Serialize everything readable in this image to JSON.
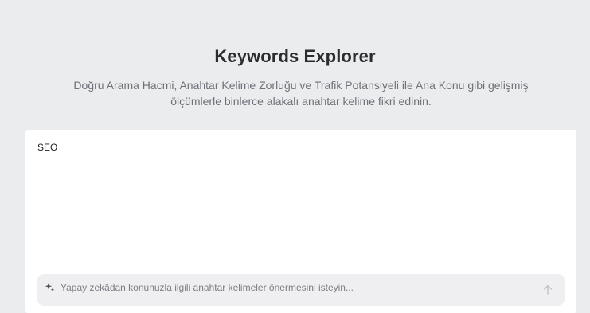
{
  "header": {
    "title": "Keywords Explorer",
    "subtitle": "Doğru Arama Hacmi, Anahtar Kelime Zorluğu ve Trafik Potansiyeli ile Ana Konu gibi gelişmiş ölçümlerle binlerce alakalı anahtar kelime fikri edinin."
  },
  "editor": {
    "keywords_value": "SEO"
  },
  "ai_prompt": {
    "icon": "sparkle-icon",
    "placeholder": "Yapay zekâdan konunuzla ilgili anahtar kelimeler önermesini isteyin...",
    "value": "",
    "send_icon": "arrow-up-icon"
  },
  "colors": {
    "background": "#ebecee",
    "card": "#ffffff",
    "ai_bar": "#efeff1",
    "title_text": "#2a2c30",
    "subtitle_text": "#6e7178",
    "disabled_icon": "#c2c5ca"
  }
}
